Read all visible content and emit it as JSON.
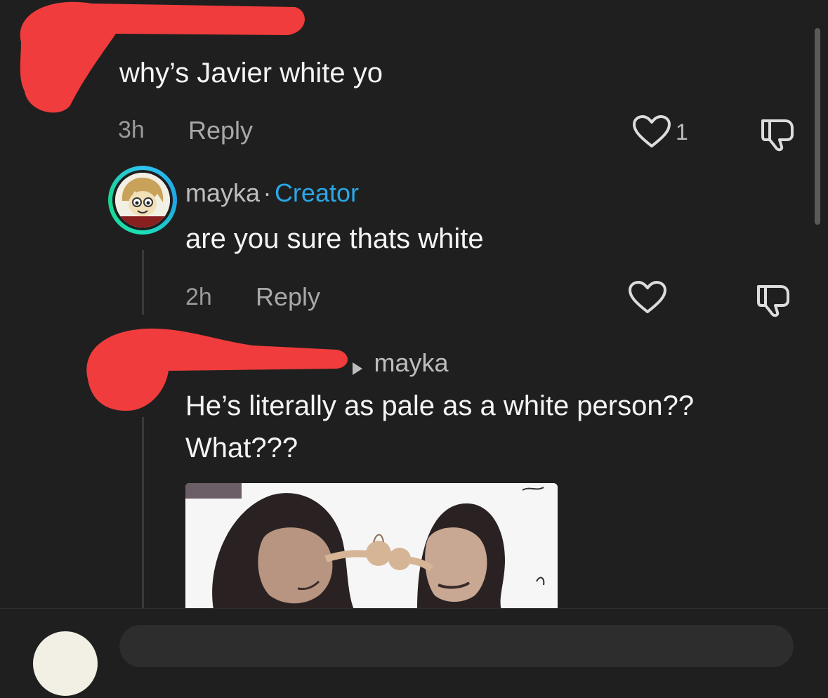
{
  "comments": [
    {
      "username": "",
      "text": "why’s Javier white yo",
      "time": "3h",
      "reply_label": "Reply",
      "like_count": "1"
    },
    {
      "username": "mayka",
      "separator": "·",
      "badge": "Creator",
      "text": "are you sure thats white",
      "time": "2h",
      "reply_label": "Reply"
    },
    {
      "username": "",
      "reply_to": "mayka",
      "text_lines": [
        "He’s literally as pale as a white person??",
        "What???"
      ]
    }
  ],
  "colors": {
    "background": "#1f1f1f",
    "creator_badge": "#2aa7e6",
    "redaction": "#f03c3c"
  },
  "icons": {
    "like": "heart-outline",
    "dislike": "thumbs-down-outline",
    "reply_arrow": "triangle-right"
  }
}
